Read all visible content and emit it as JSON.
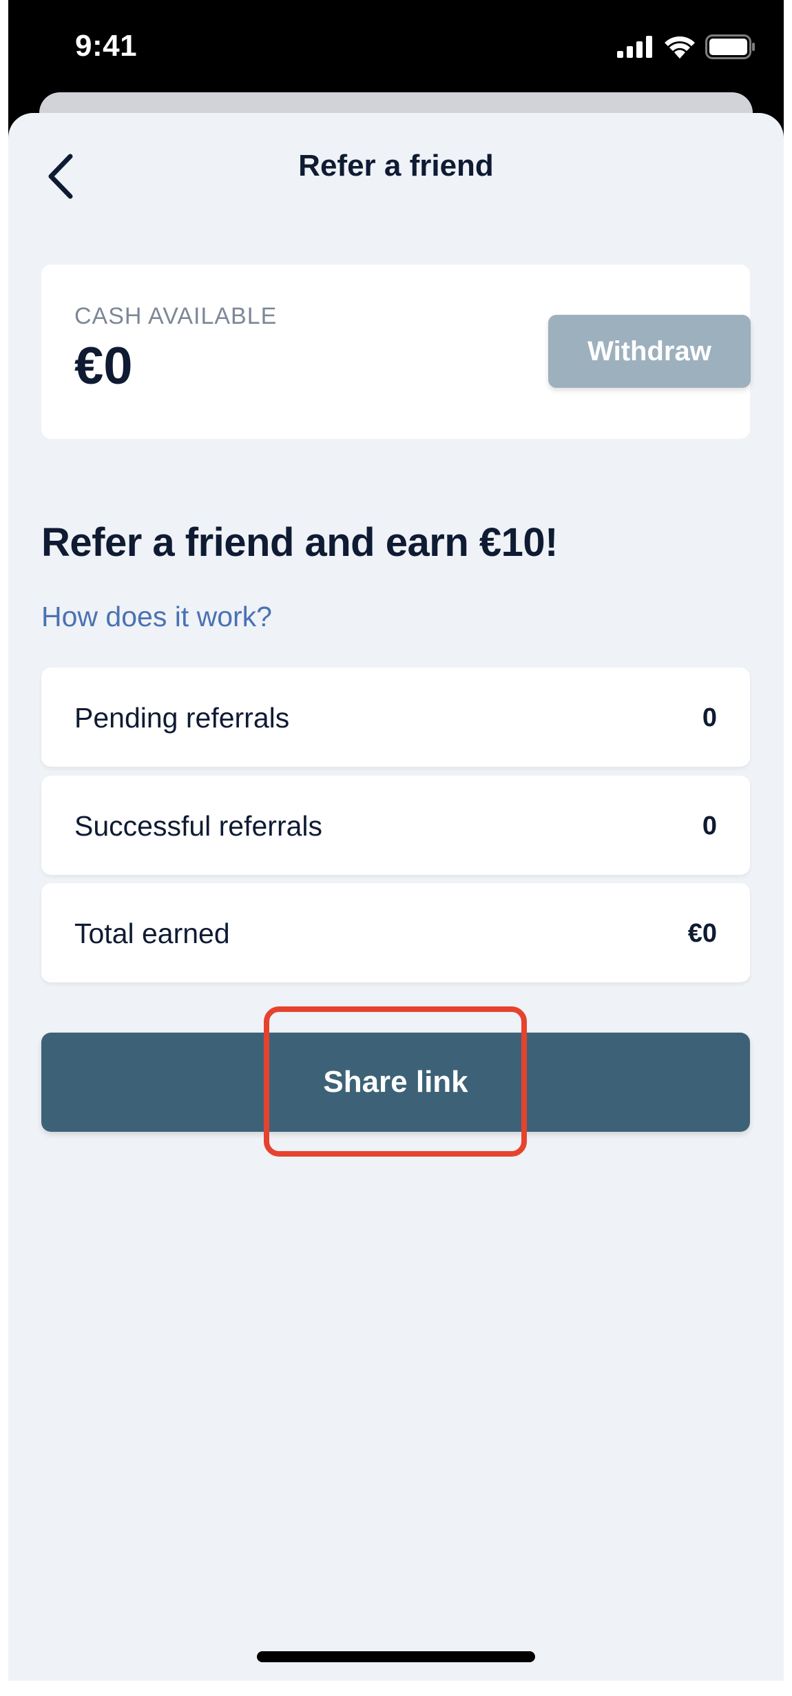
{
  "status_bar": {
    "time": "9:41"
  },
  "header": {
    "title": "Refer a friend",
    "back_icon": "chevron-left-icon"
  },
  "cash": {
    "label": "CASH AVAILABLE",
    "value": "€0",
    "withdraw_label": "Withdraw"
  },
  "promo": {
    "heading": "Refer a friend and earn €10!",
    "how_link": "How does it work?"
  },
  "stats": [
    {
      "label": "Pending referrals",
      "value": "0"
    },
    {
      "label": "Successful referrals",
      "value": "0"
    },
    {
      "label": "Total earned",
      "value": "€0"
    }
  ],
  "share_button_label": "Share link",
  "colors": {
    "accent_button": "#3d6278",
    "disabled_button": "#9db0be",
    "link": "#4a72b3",
    "highlight": "#e5432e",
    "background": "#eff2f6"
  }
}
